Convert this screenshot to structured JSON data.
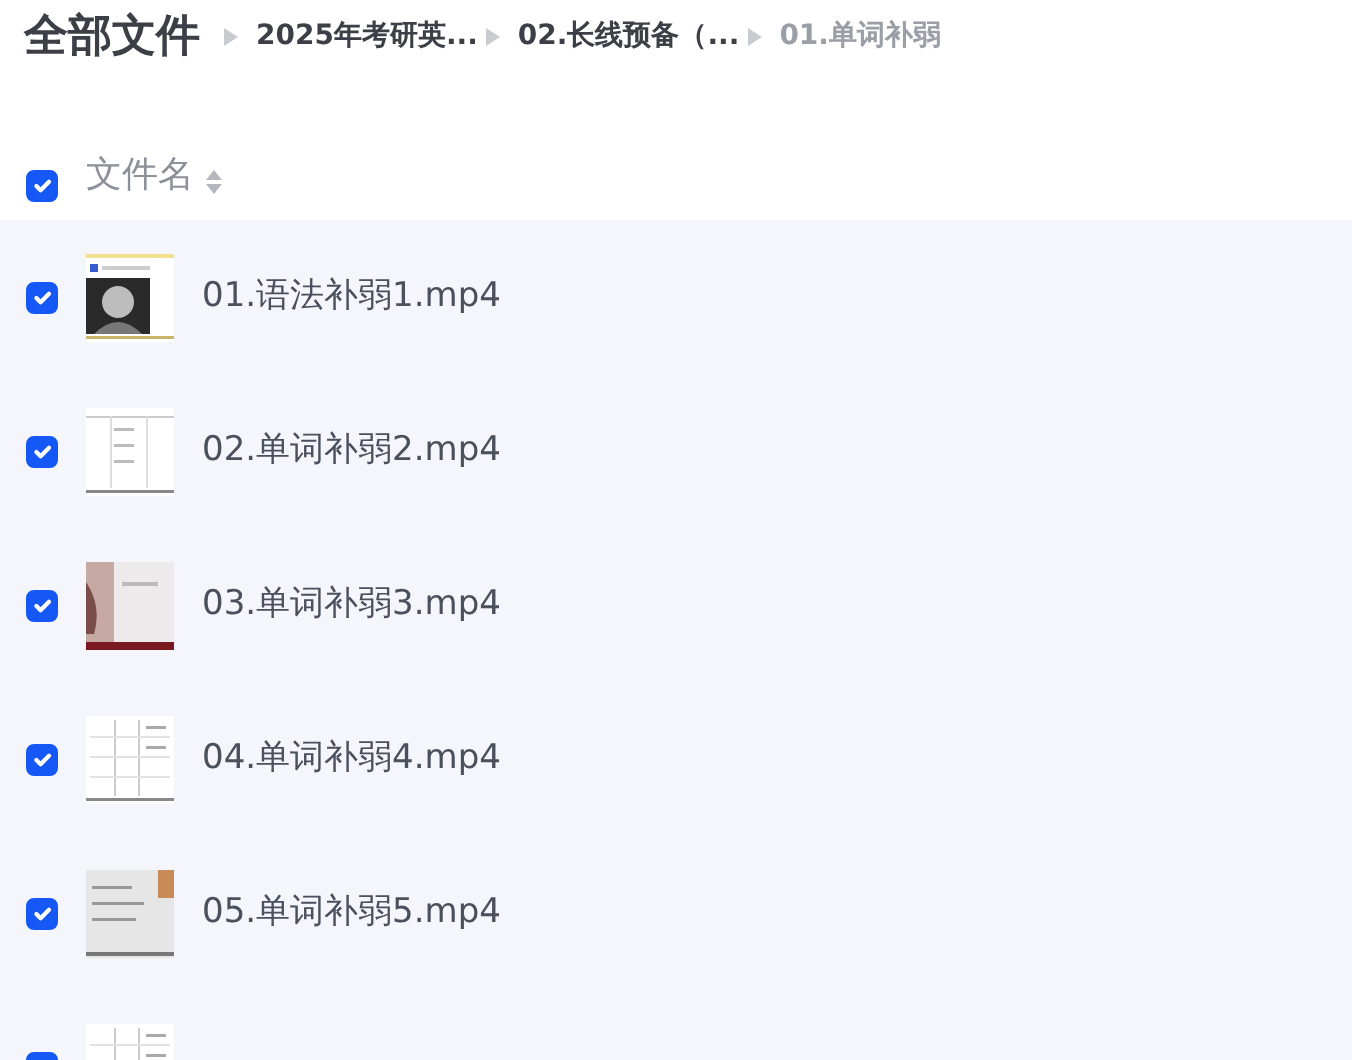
{
  "title": "全部文件",
  "breadcrumb": [
    {
      "label": "2025年考研英...",
      "current": false
    },
    {
      "label": "02.长线预备（...",
      "current": false
    },
    {
      "label": "01.单词补弱",
      "current": true
    }
  ],
  "header": {
    "checked": true,
    "column": "文件名"
  },
  "rows": [
    {
      "kind": "file",
      "checked": true,
      "name": "01.语法补弱1.mp4"
    },
    {
      "kind": "file",
      "checked": true,
      "name": "02.单词补弱2.mp4"
    },
    {
      "kind": "file",
      "checked": true,
      "name": "03.单词补弱3.mp4"
    },
    {
      "kind": "file",
      "checked": true,
      "name": "04.单词补弱4.mp4"
    },
    {
      "kind": "file",
      "checked": true,
      "name": "05.单词补弱5.mp4"
    },
    {
      "kind": "partial",
      "checked": true
    }
  ]
}
